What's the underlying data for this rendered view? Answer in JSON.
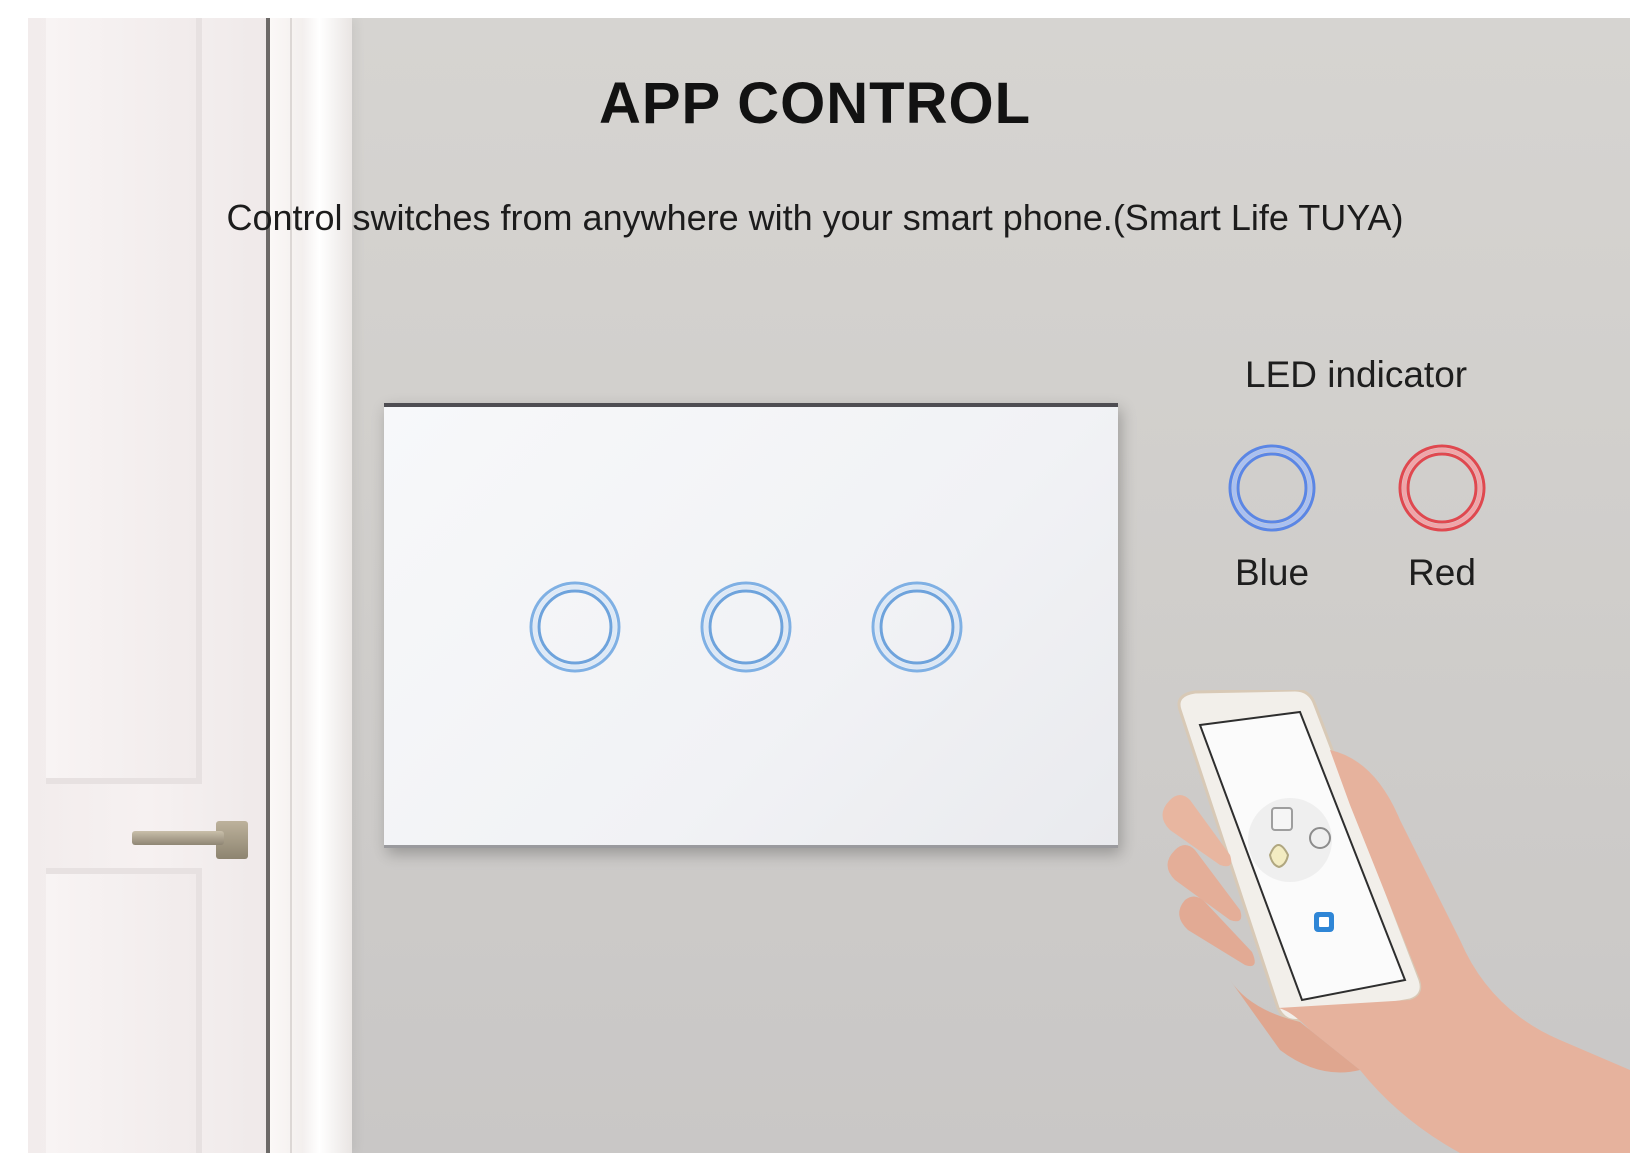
{
  "header": {
    "title": "APP CONTROL",
    "subtitle": "Control switches from anywhere with your smart phone.(Smart Life TUYA)"
  },
  "switch_panel": {
    "gang_count": 3,
    "button_icon": "touch-ring-icon",
    "button_color": "#6ea3dc"
  },
  "led_indicator": {
    "title": "LED indicator",
    "options": [
      {
        "label": "Blue",
        "color": "#5b86e5",
        "icon": "blue-led-ring-icon"
      },
      {
        "label": "Red",
        "color": "#e0484f",
        "icon": "red-led-ring-icon"
      }
    ]
  },
  "phone": {
    "icon": "smartphone-icon",
    "app_icons": [
      "socket-icon",
      "bulb-icon",
      "fan-icon",
      "switch-app-icon"
    ]
  }
}
